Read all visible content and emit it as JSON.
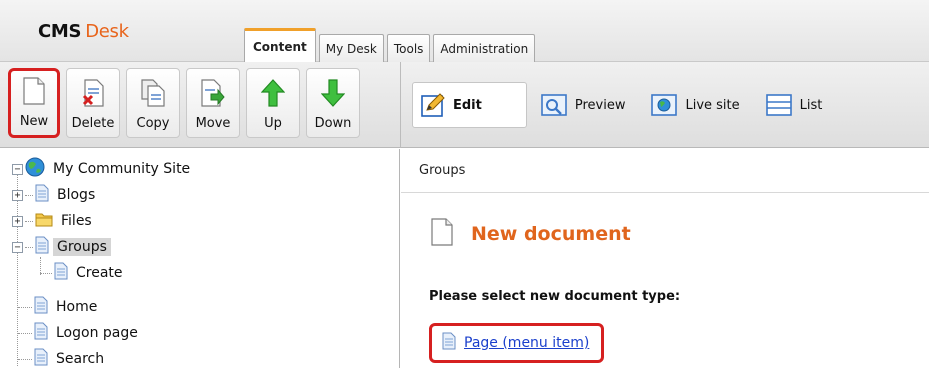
{
  "header": {
    "logo_main": "CMS",
    "logo_accent": "Desk",
    "tabs": [
      {
        "label": "Content",
        "active": true
      },
      {
        "label": "My Desk",
        "active": false
      },
      {
        "label": "Tools",
        "active": false
      },
      {
        "label": "Administration",
        "active": false
      }
    ]
  },
  "toolbar": {
    "actions": [
      {
        "label": "New",
        "icon": "new-document-icon"
      },
      {
        "label": "Delete",
        "icon": "delete-document-icon"
      },
      {
        "label": "Copy",
        "icon": "copy-document-icon"
      },
      {
        "label": "Move",
        "icon": "move-document-icon"
      },
      {
        "label": "Up",
        "icon": "arrow-up-icon"
      },
      {
        "label": "Down",
        "icon": "arrow-down-icon"
      }
    ],
    "modes": [
      {
        "label": "Edit",
        "icon": "edit-icon",
        "active": true
      },
      {
        "label": "Preview",
        "icon": "preview-icon",
        "active": false
      },
      {
        "label": "Live site",
        "icon": "live-site-icon",
        "active": false
      },
      {
        "label": "List",
        "icon": "list-icon",
        "active": false
      }
    ]
  },
  "tree": {
    "root": "My Community Site",
    "items": [
      {
        "label": "Blogs"
      },
      {
        "label": "Files"
      },
      {
        "label": "Groups",
        "selected": true
      },
      {
        "label": "Create"
      },
      {
        "label": "Home"
      },
      {
        "label": "Logon page"
      },
      {
        "label": "Search"
      }
    ]
  },
  "content": {
    "breadcrumb": "Groups",
    "title": "New document",
    "prompt": "Please select new document type:",
    "doc_types": [
      {
        "label": "Page (menu item)"
      }
    ]
  },
  "colors": {
    "accent_orange": "#e0651d",
    "highlight_red": "#d62020",
    "link_blue": "#1a3fcc"
  }
}
